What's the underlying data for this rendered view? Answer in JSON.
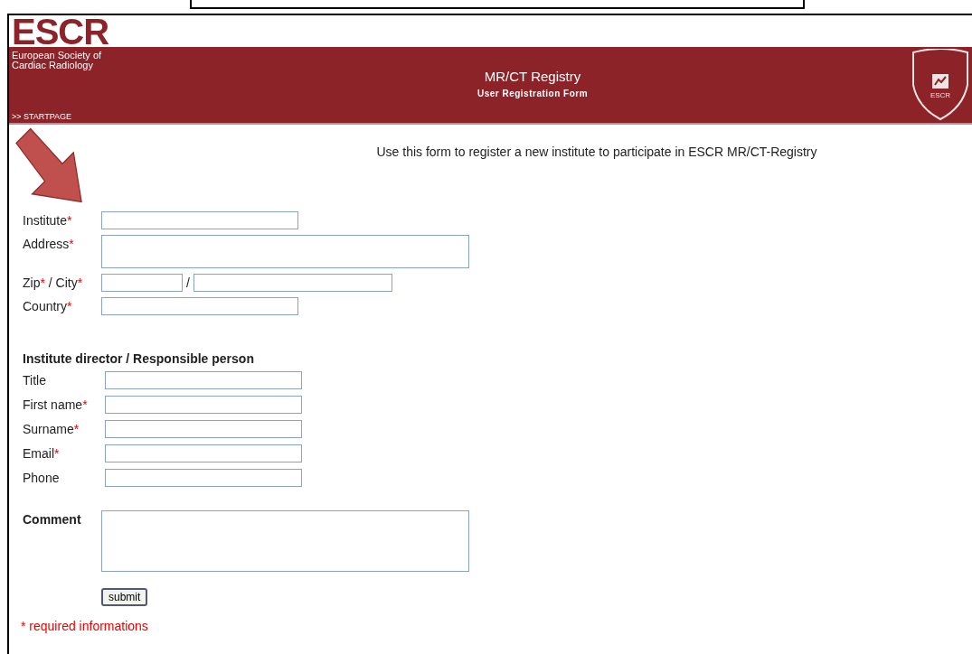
{
  "header": {
    "logo": "ESCR",
    "society": [
      "European Society of",
      "Cardiac Radiology"
    ],
    "startpage_link": ">> STARTPAGE",
    "title": "MR/CT Registry",
    "subtitle": "User Registration Form",
    "badge_text": "ESCR"
  },
  "intro": "Use this form to register a new institute to participate in ESCR MR/CT-Registry",
  "required_mark": "*",
  "institute_fields": [
    {
      "kind": "text",
      "label": "Institute",
      "required": true
    },
    {
      "kind": "textarea",
      "label": "Address",
      "required": true
    },
    {
      "kind": "pair",
      "separator": "/",
      "input_separator": "/",
      "parts": [
        {
          "label": "Zip",
          "required": true
        },
        {
          "label": "City",
          "required": true
        }
      ]
    },
    {
      "kind": "text",
      "label": "Country",
      "required": true
    }
  ],
  "person_section": {
    "heading": "Institute director / Responsible person",
    "fields": [
      {
        "label": "Title",
        "required": false
      },
      {
        "label": "First name",
        "required": true
      },
      {
        "label": "Surname",
        "required": true
      },
      {
        "label": "Email",
        "required": true
      },
      {
        "label": "Phone",
        "required": false
      }
    ]
  },
  "comment": {
    "label": "Comment"
  },
  "submit_button": "submit",
  "required_note": "* required informations"
}
